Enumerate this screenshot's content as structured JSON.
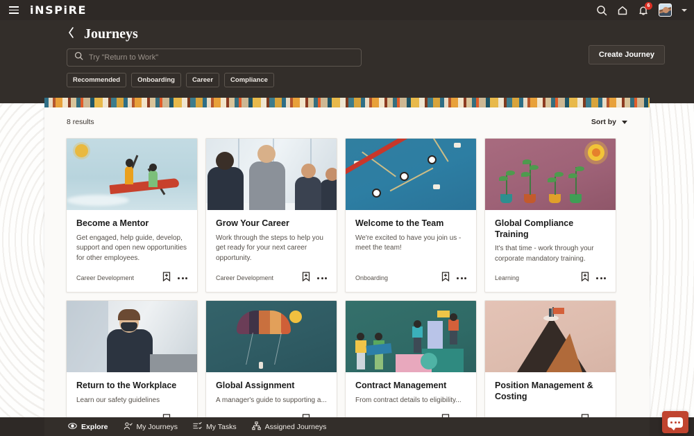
{
  "topbar": {
    "brand": "iNSPiRE",
    "menu_icon": "hamburger-icon",
    "search_icon": "search-icon",
    "home_icon": "home-icon",
    "notifications_icon": "bell-icon",
    "notification_count": "6",
    "avatar_icon": "user-avatar",
    "chevron_icon": "chevron-down-icon"
  },
  "header": {
    "back_icon": "chevron-left-icon",
    "title": "Journeys",
    "create_button": "Create Journey",
    "search": {
      "placeholder": "Try \"Return to Work\"",
      "value": "",
      "icon": "search-icon"
    },
    "chips": [
      {
        "label": "Recommended"
      },
      {
        "label": "Onboarding"
      },
      {
        "label": "Career"
      },
      {
        "label": "Compliance"
      }
    ]
  },
  "results": {
    "count_label": "8 results",
    "sort_label": "Sort by",
    "sort_icon": "caret-down-icon"
  },
  "cards": [
    {
      "title": "Become a Mentor",
      "description": "Get engaged, help guide, develop, support and open new opportunities for other employees.",
      "category": "Career Development",
      "bookmark_icon": "bookmark-add-icon",
      "more_icon": "more-options-icon",
      "art": "kayakers-illustration"
    },
    {
      "title": "Grow Your Career",
      "description": "Work through the steps to help you get ready for your next career opportunity.",
      "category": "Career Development",
      "bookmark_icon": "bookmark-add-icon",
      "more_icon": "more-options-icon",
      "art": "business-handshake-photo"
    },
    {
      "title": "Welcome to the Team",
      "description": "We're excited to have you join us - meet the team!",
      "category": "Onboarding",
      "bookmark_icon": "bookmark-add-icon",
      "more_icon": "more-options-icon",
      "art": "rowing-scull-illustration"
    },
    {
      "title": "Global Compliance Training",
      "description": "It's that time - work through your corporate mandatory training.",
      "category": "Learning",
      "bookmark_icon": "bookmark-add-icon",
      "more_icon": "more-options-icon",
      "art": "potted-plants-sun-illustration"
    },
    {
      "title": "Return to the Workplace",
      "description": "Learn our safety guidelines",
      "category": "",
      "bookmark_icon": "bookmark-add-icon",
      "more_icon": "more-options-icon",
      "art": "masked-worker-photo"
    },
    {
      "title": "Global Assignment",
      "description": "A manager's guide to supporting a...",
      "category": "",
      "bookmark_icon": "bookmark-add-icon",
      "more_icon": "more-options-icon",
      "art": "parachute-illustration"
    },
    {
      "title": "Contract Management",
      "description": "From contract details to eligibility...",
      "category": "",
      "bookmark_icon": "bookmark-add-icon",
      "more_icon": "more-options-icon",
      "art": "teamwork-shapes-illustration"
    },
    {
      "title": "Position Management & Costing",
      "description": "",
      "category": "",
      "bookmark_icon": "bookmark-add-icon",
      "more_icon": "more-options-icon",
      "art": "mountain-summit-illustration"
    }
  ],
  "bottom_nav": [
    {
      "label": "Explore",
      "icon": "eye-icon",
      "active": true
    },
    {
      "label": "My Journeys",
      "icon": "person-check-icon",
      "active": false
    },
    {
      "label": "My Tasks",
      "icon": "checklist-icon",
      "active": false
    },
    {
      "label": "Assigned Journeys",
      "icon": "org-chart-icon",
      "active": false
    }
  ],
  "chat": {
    "icon": "chat-bubble-icon"
  },
  "colors": {
    "topbar_bg": "#2e2926",
    "header_bg": "#332e2a",
    "panel_bg": "#fbfaf8",
    "badge_red": "#d93025",
    "chat_red": "#c0442f",
    "page_bg": "#fbfaf8"
  }
}
